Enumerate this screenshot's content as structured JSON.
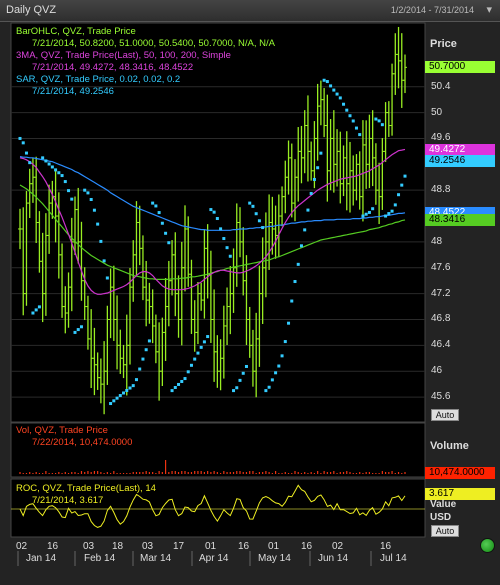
{
  "window": {
    "title": "Daily QVZ",
    "date_range": "1/2/2014 - 7/31/2014"
  },
  "price_panel": {
    "axis_title": "Price",
    "legend": [
      {
        "label": "BarOHLC, QVZ, Trade Price",
        "values": "7/21/2014, 50.8200, 51.0000, 50.5400, 50.7000, N/A, N/A",
        "color": "#99ff33"
      },
      {
        "label": "3MA, QVZ, Trade Price(Last), 50, 100, 200, Simple",
        "values": "7/21/2014, 49.4272, 48.3416, 48.4522",
        "color": "#dd33dd"
      },
      {
        "label": "SAR, QVZ, Trade Price, 0.02, 0.02, 0.2",
        "values": "7/21/2014, 49.2546",
        "color": "#33ccff"
      }
    ],
    "y_ticks": [
      "50.4",
      "50",
      "49.6",
      "48.8",
      "48",
      "47.6",
      "47.2",
      "46.8",
      "46.4",
      "46",
      "45.6"
    ],
    "y_tick_values": [
      50.4,
      50,
      49.6,
      48.8,
      48,
      47.6,
      47.2,
      46.8,
      46.4,
      46,
      45.6
    ],
    "value_badges": [
      {
        "text": "50.7000",
        "value": 50.7,
        "bg": "#99ff33",
        "fg": "#000000"
      },
      {
        "text": "49.4272",
        "value": 49.4272,
        "bg": "#dd33dd",
        "fg": "#ffffff"
      },
      {
        "text": "49.2546",
        "value": 49.2546,
        "bg": "#33ccff",
        "fg": "#000000"
      },
      {
        "text": "48.4522",
        "value": 48.4522,
        "bg": "#2a8cff",
        "fg": "#ffffff"
      },
      {
        "text": "48.3416",
        "value": 48.3416,
        "bg": "#55cc22",
        "fg": "#000000"
      }
    ],
    "auto_label": "Auto"
  },
  "volume_panel": {
    "axis_title": "Volume",
    "legend": [
      {
        "label": "Vol, QVZ, Trade Price",
        "values": "7/22/2014, 10,474.0000",
        "color": "#ff4422"
      }
    ],
    "badge": {
      "text": "10,474.0000",
      "bg": "#ff2200",
      "fg": "#000000"
    }
  },
  "roc_panel": {
    "axis_titles": [
      "Value",
      "USD"
    ],
    "legend": [
      {
        "label": "ROC, QVZ, Trade Price(Last), 14",
        "values": "7/21/2014, 3.617",
        "color": "#eeee22"
      }
    ],
    "badge": {
      "text": "3.617",
      "bg": "#eeee22",
      "fg": "#000000"
    },
    "auto_label": "Auto"
  },
  "x_axis": {
    "day_ticks": [
      "02",
      "16",
      "03",
      "18",
      "03",
      "17",
      "01",
      "16",
      "01",
      "16",
      "02",
      "16"
    ],
    "month_ticks": [
      "Jan 14",
      "Feb 14",
      "Mar 14",
      "Apr 14",
      "May 14",
      "Jun 14",
      "Jul 14"
    ]
  },
  "chart_data": {
    "type": "ohlc",
    "y_range": [
      45.4,
      51.2
    ],
    "volume_marker_value": 10474,
    "close": [
      48.2,
      47.2,
      48.6,
      48.9,
      49.0,
      48.3,
      47.7,
      47.2,
      48.1,
      48.6,
      48.7,
      48.4,
      47.8,
      47.0,
      46.9,
      47.3,
      48.0,
      48.5,
      48.0,
      47.4,
      47.0,
      46.5,
      46.2,
      46.1,
      45.9,
      45.8,
      46.0,
      46.8,
      47.3,
      46.8,
      46.4,
      46.2,
      46.1,
      46.4,
      47.3,
      47.8,
      48.3,
      47.9,
      47.3,
      47.1,
      47.0,
      46.7,
      46.3,
      46.0,
      46.6,
      47.0,
      47.4,
      47.8,
      47.2,
      46.8,
      47.6,
      48.2,
      47.5,
      46.8,
      46.6,
      47.2,
      47.1,
      47.9,
      47.5,
      46.8,
      46.3,
      46.0,
      46.2,
      46.7,
      47.0,
      47.2,
      47.6,
      48.3,
      48.0,
      47.4,
      46.8,
      46.4,
      46.0,
      46.5,
      47.2,
      47.6,
      48.0,
      48.3,
      48.2,
      48.1,
      48.4,
      48.7,
      49.0,
      49.3,
      48.6,
      49.0,
      49.4,
      49.3,
      49.8,
      49.4,
      49.1,
      49.6,
      50.1,
      50.2,
      49.8,
      49.1,
      49.6,
      49.2,
      49.4,
      48.9,
      49.3,
      48.9,
      49.1,
      48.8,
      49.2,
      48.7,
      49.5,
      49.2,
      49.6,
      49.3,
      48.8,
      48.7,
      49.4,
      50.0,
      49.8,
      50.6,
      50.9,
      50.8,
      50.5,
      50.7
    ],
    "ma50": [
      49.3,
      49.29,
      49.27,
      49.24,
      49.2,
      49.15,
      49.08,
      49.01,
      48.93,
      48.83,
      48.73,
      48.62,
      48.5,
      48.38,
      48.25,
      48.12,
      47.98,
      47.84,
      47.69,
      47.55,
      47.42,
      47.32,
      47.25,
      47.21,
      47.19,
      47.19,
      47.2,
      47.21,
      47.23,
      47.25,
      47.27,
      47.29,
      47.31,
      47.34,
      47.38,
      47.43,
      47.48,
      47.52,
      47.54,
      47.54,
      47.52,
      47.48,
      47.42,
      47.37,
      47.32,
      47.29,
      47.27,
      47.26,
      47.26,
      47.26,
      47.26,
      47.27,
      47.28,
      47.3,
      47.32,
      47.35,
      47.38,
      47.42,
      47.46,
      47.5,
      47.53,
      47.55,
      47.56,
      47.56,
      47.55,
      47.54,
      47.53,
      47.52,
      47.52,
      47.53,
      47.55,
      47.57,
      47.6,
      47.63,
      47.67,
      47.72,
      47.77,
      47.84,
      47.92,
      48.01,
      48.11,
      48.21,
      48.3,
      48.38,
      48.45,
      48.51,
      48.56,
      48.6,
      48.64,
      48.68,
      48.72,
      48.76,
      48.8,
      48.83,
      48.86,
      48.89,
      48.91,
      48.93,
      48.95,
      48.97,
      48.98,
      48.99,
      49.0,
      49.01,
      49.02,
      49.04,
      49.06,
      49.08,
      49.1,
      49.13,
      49.16,
      49.19,
      49.23,
      49.27,
      49.31,
      49.35,
      49.38,
      49.41,
      49.42,
      49.43
    ],
    "ma100": [
      48.88,
      48.85,
      48.82,
      48.78,
      48.74,
      48.69,
      48.64,
      48.59,
      48.53,
      48.47,
      48.41,
      48.35,
      48.29,
      48.23,
      48.17,
      48.11,
      48.06,
      48.01,
      47.96,
      47.91,
      47.87,
      47.83,
      47.79,
      47.76,
      47.73,
      47.7,
      47.67,
      47.64,
      47.62,
      47.6,
      47.58,
      47.56,
      47.54,
      47.52,
      47.5,
      47.48,
      47.47,
      47.46,
      47.45,
      47.44,
      47.43,
      47.43,
      47.42,
      47.42,
      47.42,
      47.42,
      47.42,
      47.43,
      47.43,
      47.43,
      47.44,
      47.44,
      47.45,
      47.46,
      47.46,
      47.47,
      47.48,
      47.49,
      47.5,
      47.52,
      47.53,
      47.54,
      47.56,
      47.57,
      47.59,
      47.6,
      47.61,
      47.62,
      47.63,
      47.64,
      47.65,
      47.66,
      47.67,
      47.68,
      47.69,
      47.7,
      47.71,
      47.72,
      47.74,
      47.76,
      47.77,
      47.79,
      47.81,
      47.83,
      47.85,
      47.87,
      47.89,
      47.91,
      47.93,
      47.95,
      47.97,
      47.99,
      48.01,
      48.03,
      48.04,
      48.05,
      48.06,
      48.07,
      48.08,
      48.09,
      48.1,
      48.11,
      48.12,
      48.13,
      48.14,
      48.15,
      48.16,
      48.17,
      48.19,
      48.2,
      48.21,
      48.22,
      48.24,
      48.25,
      48.27,
      48.28,
      48.3,
      48.31,
      48.33,
      48.34
    ],
    "ma200": [
      49.32,
      49.31,
      49.31,
      49.3,
      49.3,
      49.29,
      49.28,
      49.27,
      49.26,
      49.25,
      49.24,
      49.22,
      49.2,
      49.18,
      49.16,
      49.14,
      49.12,
      49.09,
      49.07,
      49.04,
      49.01,
      48.98,
      48.95,
      48.92,
      48.89,
      48.86,
      48.83,
      48.8,
      48.76,
      48.73,
      48.7,
      48.67,
      48.64,
      48.61,
      48.58,
      48.55,
      48.53,
      48.51,
      48.49,
      48.47,
      48.45,
      48.43,
      48.41,
      48.39,
      48.37,
      48.35,
      48.33,
      48.31,
      48.29,
      48.27,
      48.25,
      48.24,
      48.23,
      48.22,
      48.21,
      48.2,
      48.19,
      48.19,
      48.18,
      48.18,
      48.18,
      48.18,
      48.18,
      48.18,
      48.18,
      48.18,
      48.19,
      48.19,
      48.2,
      48.2,
      48.2,
      48.21,
      48.21,
      48.22,
      48.22,
      48.23,
      48.23,
      48.24,
      48.24,
      48.25,
      48.26,
      48.26,
      48.27,
      48.28,
      48.29,
      48.29,
      48.3,
      48.31,
      48.31,
      48.32,
      48.32,
      48.33,
      48.33,
      48.33,
      48.34,
      48.34,
      48.34,
      48.34,
      48.35,
      48.35,
      48.35,
      48.35,
      48.35,
      48.36,
      48.36,
      48.36,
      48.37,
      48.37,
      48.38,
      48.38,
      48.39,
      48.39,
      48.4,
      48.41,
      48.41,
      48.42,
      48.43,
      48.44,
      48.44,
      48.45
    ]
  }
}
